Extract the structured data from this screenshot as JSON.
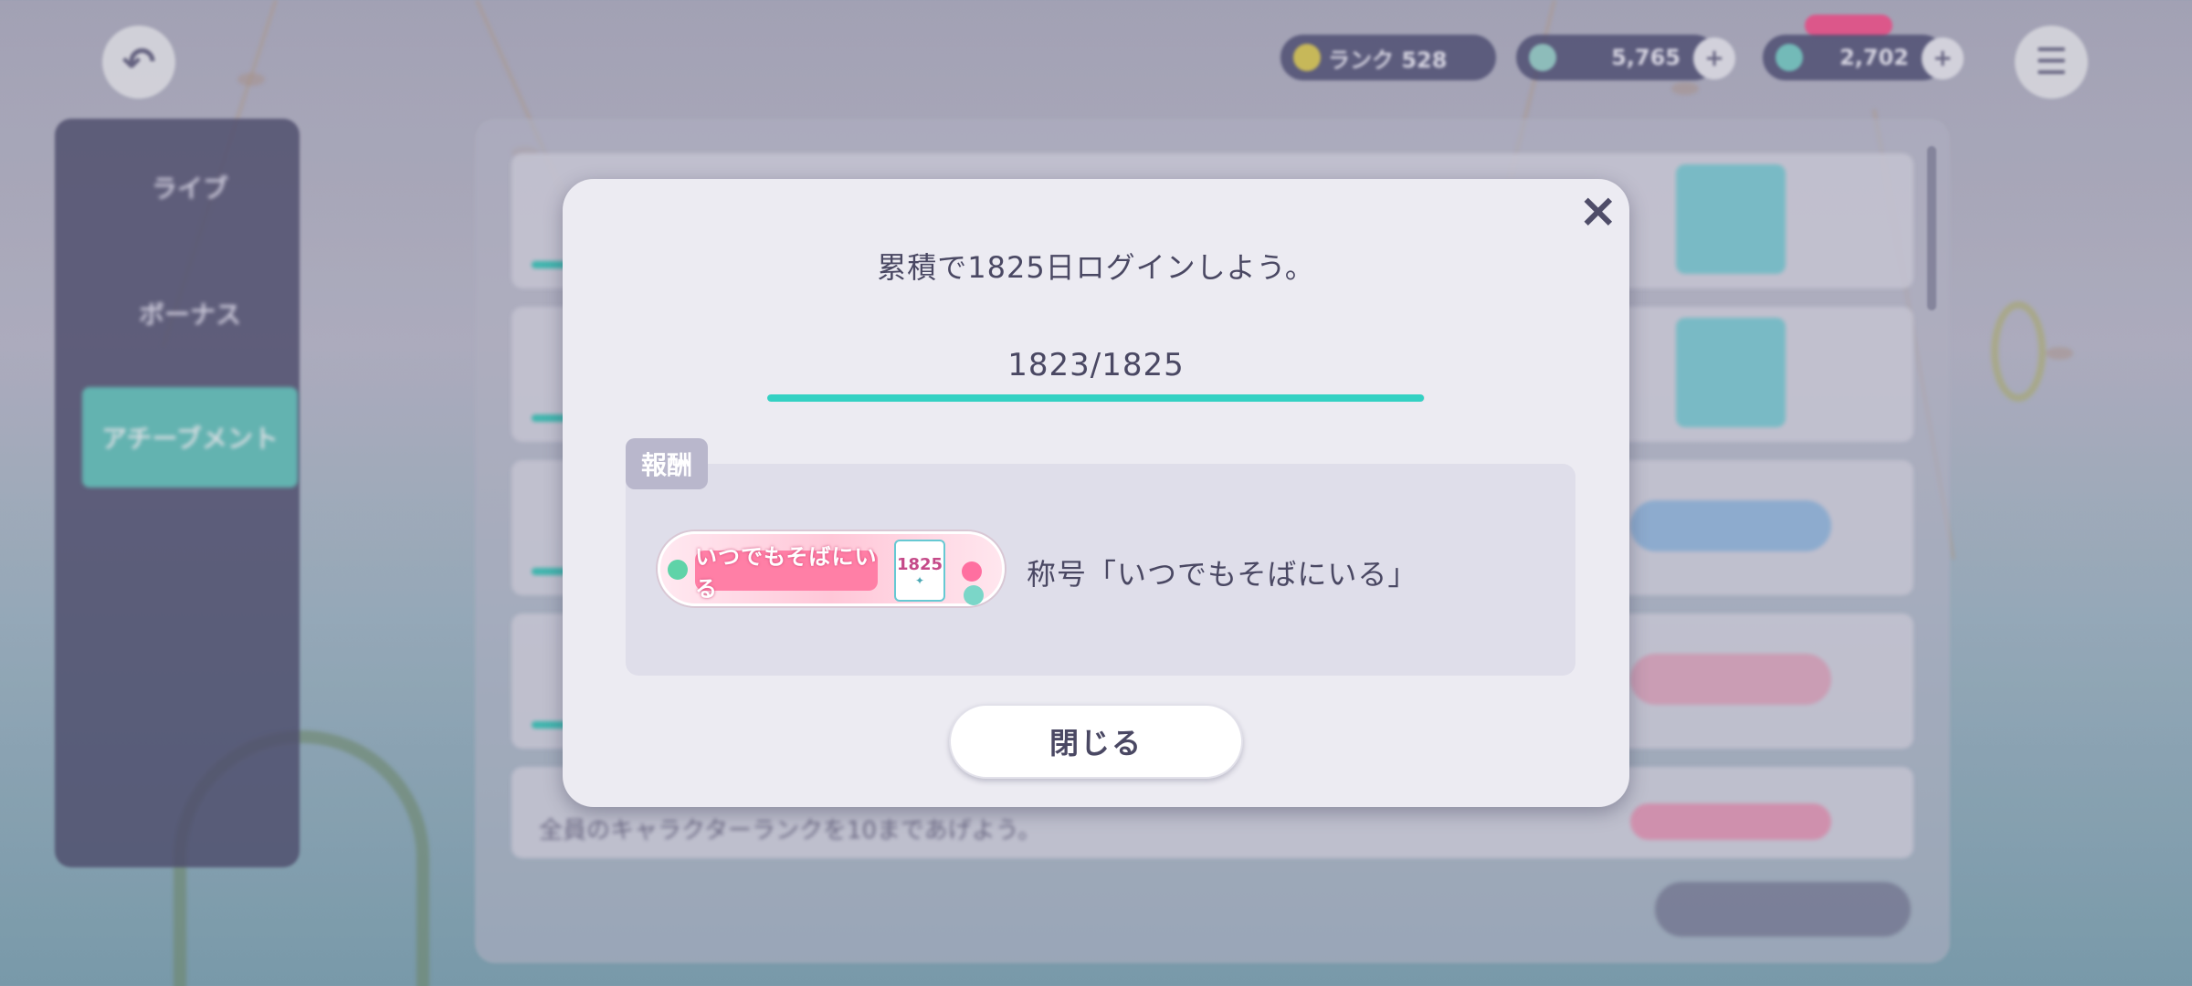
{
  "header": {
    "currencies": [
      {
        "name": "rank",
        "value": "ランク 528",
        "icon": "ticket-icon"
      },
      {
        "name": "crystal",
        "value": "5,765",
        "icon": "crystal-icon"
      },
      {
        "name": "virtual-coin",
        "value": "2,702",
        "icon": "coin-icon"
      }
    ]
  },
  "sidebar": {
    "tabs": [
      {
        "label": "ライブ"
      },
      {
        "label": "ボーナス"
      },
      {
        "label": "アチーブメント",
        "active": true
      }
    ]
  },
  "list": {
    "last_row_text": "全員のキャラクターランクを10まであげよう。"
  },
  "dialog": {
    "title": "累積で1825日ログインしよう。",
    "progress_text": "1823/1825",
    "progress_fraction": 0.9989,
    "reward_tag": "報酬",
    "reward_badge_text": "いつでもそばにいる",
    "reward_badge_number": "1825",
    "reward_name": "称号「いつでもそばにいる」",
    "close_label": "閉じる"
  },
  "colors": {
    "accent": "#33d1c3",
    "dialog_bg": "#ecebf2",
    "text": "#4a4863"
  }
}
